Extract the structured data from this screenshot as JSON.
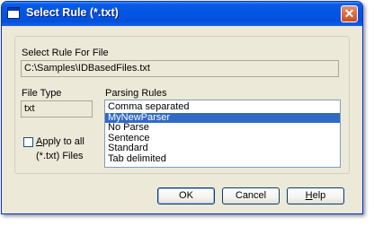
{
  "window": {
    "title": "Select Rule (*.txt)",
    "close_glyph": "✕"
  },
  "rule_for_file": {
    "label": "Select Rule For File",
    "value": "C:\\Samples\\IDBasedFiles.txt"
  },
  "file_type": {
    "label": "File Type",
    "value": "txt"
  },
  "parsing_rules": {
    "label": "Parsing Rules",
    "items": [
      {
        "label": "Comma separated",
        "selected": false
      },
      {
        "label": "MyNewParser",
        "selected": true
      },
      {
        "label": "No Parse",
        "selected": false
      },
      {
        "label": "Sentence",
        "selected": false
      },
      {
        "label": "Standard",
        "selected": false
      },
      {
        "label": "Tab delimited",
        "selected": false
      }
    ]
  },
  "apply_all": {
    "checked": false,
    "label_mnemonic": "A",
    "label_rest": "pply to all",
    "label_line2": "(*.txt) Files"
  },
  "buttons": {
    "ok": "OK",
    "cancel": "Cancel",
    "help_mnemonic": "H",
    "help_rest": "elp"
  }
}
